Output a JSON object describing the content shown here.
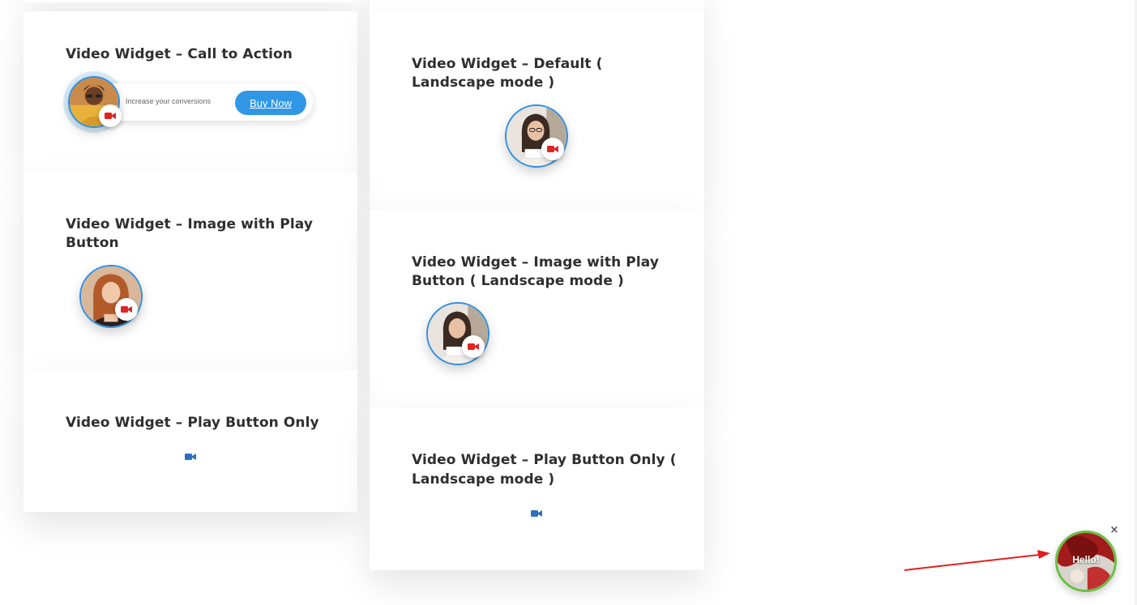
{
  "cards": {
    "cta": {
      "title": "Video Widget – Call to Action",
      "cta_text": "Increase your conversions",
      "button_label": "Buy Now"
    },
    "default_landscape": {
      "title_line1": "Video Widget – Default (",
      "title_line2": "Landscape mode )"
    },
    "image_play": {
      "title_line1": "Video Widget – Image with Play",
      "title_line2": "Button"
    },
    "image_play_landscape": {
      "title_line1": "Video Widget – Image with Play",
      "title_line2": "Button ( Landscape mode )"
    },
    "play_only": {
      "title": "Video Widget – Play Button Only"
    },
    "play_only_landscape": {
      "title_line1": "Video Widget – Play Button Only (",
      "title_line2": "Landscape mode )"
    }
  },
  "floating_widget": {
    "label": "Hello!",
    "close_symbol": "×"
  },
  "icons": {
    "camera": "video-camera-icon",
    "close": "close-icon"
  },
  "colors": {
    "accent_blue": "#2f97e6",
    "camera_red": "#e02424",
    "camera_blue": "#2f6fbf",
    "widget_border_green": "#6abf45",
    "arrow_red": "#e0201e"
  }
}
